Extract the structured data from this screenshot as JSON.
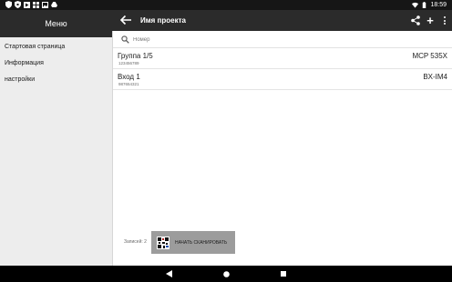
{
  "statusbar": {
    "time": "18:59"
  },
  "drawer": {
    "title": "Меню",
    "items": [
      {
        "label": "Стартовая страница"
      },
      {
        "label": "Информация"
      },
      {
        "label": "настройки"
      }
    ]
  },
  "toolbar": {
    "title": "Имя проекта",
    "icons": [
      "back-arrow-icon",
      "share-icon",
      "add-icon",
      "more-vert-icon"
    ]
  },
  "search": {
    "placeholder": "Номер"
  },
  "list": [
    {
      "name": "Группа 1/5",
      "serial": "123456789",
      "model": "MCP 535X"
    },
    {
      "name": "Вход 1",
      "serial": "987654321",
      "model": "BX-IM4"
    }
  ],
  "footer": {
    "records": "Записей: 2",
    "scan_label": "НАЧАТЬ СКАНИРОВАТЬ"
  },
  "colors": {
    "toolbar": "#2b2b2b",
    "drawer": "#ededed",
    "scan_button": "#9c9c9c"
  }
}
